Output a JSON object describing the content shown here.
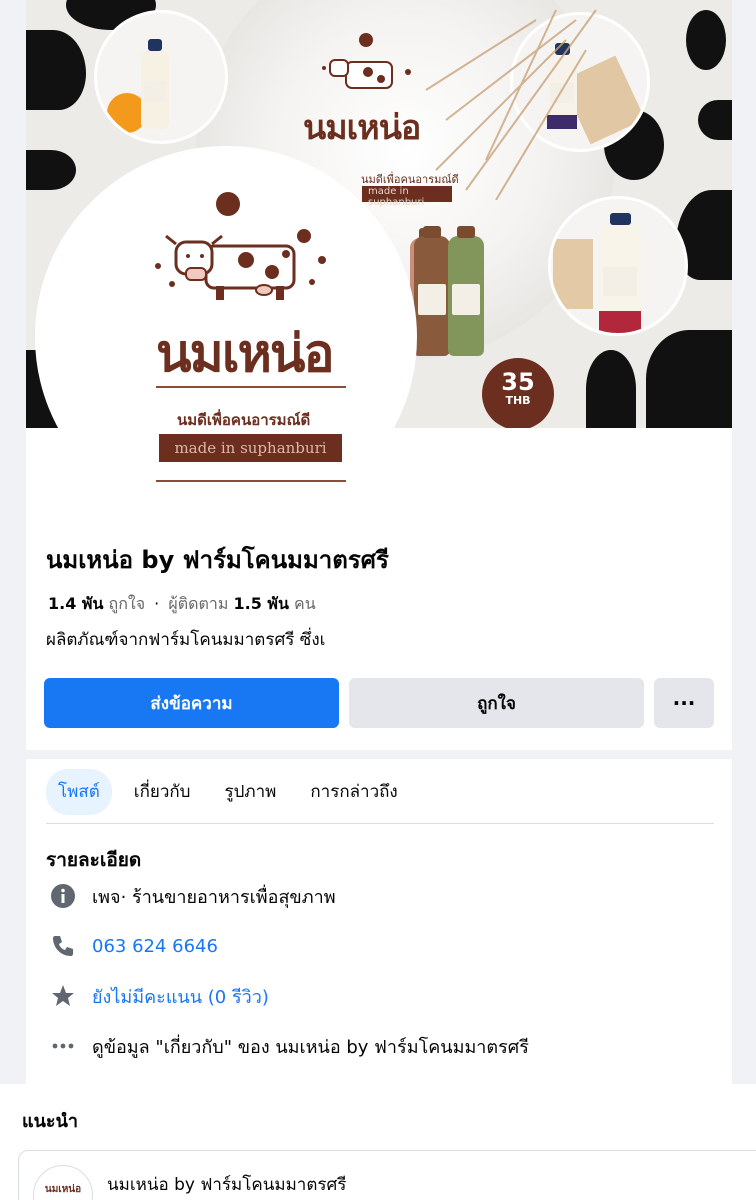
{
  "cover": {
    "brand": "นมเหน่อ",
    "tagline": "นมดีเพื่อคนอารมณ์ดี",
    "made_in": "made in suphanburi",
    "price_value": "35",
    "price_unit": "THB"
  },
  "avatar": {
    "brand": "นมเหน่อ",
    "tagline": "นมดีเพื่อคนอารมณ์ดี",
    "made_in": "made in suphanburi"
  },
  "page": {
    "name": "นมเหน่อ by ฟาร์มโคนมมาตรศรี",
    "likes_count": "1.4 พัน",
    "likes_label": "ถูกใจ",
    "separator": "·",
    "followers_label": "ผู้ติดตาม",
    "followers_count": "1.5 พัน",
    "followers_unit": "คน",
    "description": "ผลิตภัณฑ์จากฟาร์มโคนมมาตรศรี ซึ่งเ"
  },
  "actions": {
    "message": "ส่งข้อความ",
    "like": "ถูกใจ",
    "more": "···"
  },
  "tabs": [
    {
      "label": "โพสต์"
    },
    {
      "label": "เกี่ยวกับ"
    },
    {
      "label": "รูปภาพ"
    },
    {
      "label": "การกล่าวถึง"
    }
  ],
  "details": {
    "title": "รายละเอียด",
    "category_prefix": "เพจ",
    "category": " · ร้านขายอาหารเพื่อสุขภาพ",
    "phone": "063 624 6646",
    "rating": "ยังไม่มีคะแนน (0 รีวิว)",
    "about_link": "ดูข้อมูล \"เกี่ยวกับ\" ของ นมเหน่อ by ฟาร์มโคนมมาตรศรี"
  },
  "recommended": {
    "title": "แนะนำ",
    "page_name": "นมเหน่อ by ฟาร์มโคนมมาตรศรี",
    "avatar_text": "นมเหน่อ"
  },
  "colors": {
    "accent": "#1877f2",
    "brand_brown": "#6b2e1f"
  }
}
